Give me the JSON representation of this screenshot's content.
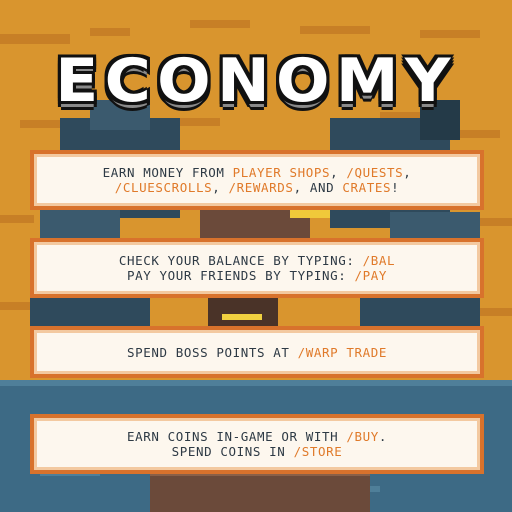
{
  "title": "ECONOMY",
  "colors": {
    "sky": "#d9952e",
    "panel_border": "#d8722c",
    "panel_fill": "#fdf7ee",
    "text": "#2e3a45",
    "highlight": "#e07a2a",
    "water": "#3d6a85"
  },
  "panels": [
    {
      "lines": [
        [
          {
            "t": "EARN MONEY FROM "
          },
          {
            "t": "PLAYER SHOPS",
            "hl": true
          },
          {
            "t": ", "
          },
          {
            "t": "/QUESTS",
            "hl": true
          },
          {
            "t": ","
          }
        ],
        [
          {
            "t": "/CLUESCROLLS",
            "hl": true
          },
          {
            "t": ", "
          },
          {
            "t": "/REWARDS",
            "hl": true
          },
          {
            "t": ", AND "
          },
          {
            "t": "CRATES",
            "hl": true
          },
          {
            "t": "!"
          }
        ]
      ]
    },
    {
      "lines": [
        [
          {
            "t": "CHECK YOUR BALANCE BY TYPING: "
          },
          {
            "t": "/BAL",
            "hl": true
          }
        ],
        [
          {
            "t": "PAY YOUR FRIENDS BY TYPING: "
          },
          {
            "t": "/PAY",
            "hl": true
          }
        ]
      ]
    },
    {
      "lines": [
        [
          {
            "t": "SPEND BOSS POINTS AT "
          },
          {
            "t": "/WARP TRADE",
            "hl": true
          }
        ]
      ]
    },
    {
      "lines": [
        [
          {
            "t": "EARN COINS IN-GAME OR WITH "
          },
          {
            "t": "/BUY",
            "hl": true
          },
          {
            "t": "."
          }
        ],
        [
          {
            "t": "SPEND COINS IN "
          },
          {
            "t": "/STORE",
            "hl": true
          }
        ]
      ]
    }
  ]
}
